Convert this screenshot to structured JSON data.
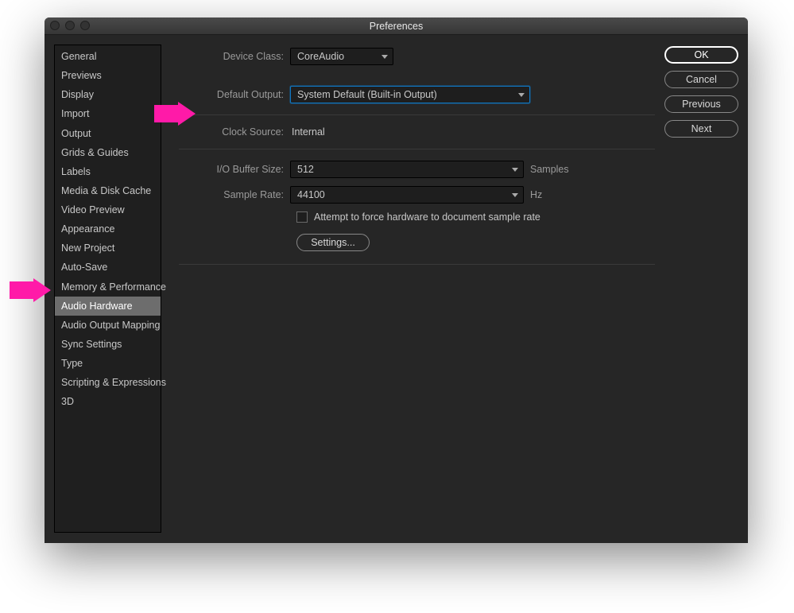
{
  "window": {
    "title": "Preferences"
  },
  "sidebar": {
    "items": [
      {
        "label": "General"
      },
      {
        "label": "Previews"
      },
      {
        "label": "Display"
      },
      {
        "label": "Import"
      },
      {
        "label": "Output"
      },
      {
        "label": "Grids & Guides"
      },
      {
        "label": "Labels"
      },
      {
        "label": "Media & Disk Cache"
      },
      {
        "label": "Video Preview"
      },
      {
        "label": "Appearance"
      },
      {
        "label": "New Project"
      },
      {
        "label": "Auto-Save"
      },
      {
        "label": "Memory & Performance"
      },
      {
        "label": "Audio Hardware"
      },
      {
        "label": "Audio Output Mapping"
      },
      {
        "label": "Sync Settings"
      },
      {
        "label": "Type"
      },
      {
        "label": "Scripting & Expressions"
      },
      {
        "label": "3D"
      }
    ],
    "selected_index": 13
  },
  "form": {
    "device_class": {
      "label": "Device Class:",
      "value": "CoreAudio"
    },
    "default_output": {
      "label": "Default Output:",
      "value": "System Default (Built-in Output)"
    },
    "clock_source": {
      "label": "Clock Source:",
      "value": "Internal"
    },
    "io_buffer": {
      "label": "I/O Buffer Size:",
      "value": "512",
      "unit": "Samples"
    },
    "sample_rate": {
      "label": "Sample Rate:",
      "value": "44100",
      "unit": "Hz"
    },
    "force_checkbox": {
      "label": "Attempt to force hardware to document sample rate"
    },
    "settings_button": "Settings..."
  },
  "actions": {
    "ok": "OK",
    "cancel": "Cancel",
    "previous": "Previous",
    "next": "Next"
  }
}
